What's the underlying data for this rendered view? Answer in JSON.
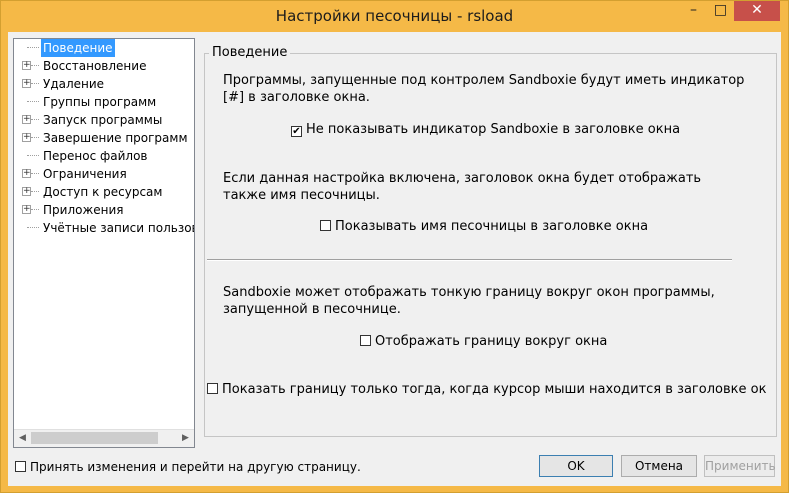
{
  "window": {
    "title": "Настройки песочницы - rsload",
    "controls": {
      "minimize": "–",
      "maximize": "□",
      "close": "✕"
    }
  },
  "tree": {
    "items": [
      {
        "label": "Поведение",
        "expander": "",
        "selected": true
      },
      {
        "label": "Восстановление",
        "expander": "+"
      },
      {
        "label": "Удаление",
        "expander": "+"
      },
      {
        "label": "Группы программ",
        "expander": ""
      },
      {
        "label": "Запуск программы",
        "expander": "+"
      },
      {
        "label": "Завершение программ",
        "expander": "+"
      },
      {
        "label": "Перенос файлов",
        "expander": ""
      },
      {
        "label": "Ограничения",
        "expander": "+"
      },
      {
        "label": "Доступ к ресурсам",
        "expander": "+"
      },
      {
        "label": "Приложения",
        "expander": "+"
      },
      {
        "label": "Учётные записи пользоват",
        "expander": ""
      }
    ],
    "scroll_left": "◀",
    "scroll_right": "▶"
  },
  "group": {
    "title": "Поведение",
    "text1": "Программы, запущенные под контролем Sandboxie будут иметь индикатор [#] в заголовке окна.",
    "cb1_label": "Не показывать индикатор Sandboxie в заголовке окна",
    "cb1_mark": "✔",
    "text2": "Если данная настройка включена, заголовок окна будет отображать также имя песочницы.",
    "cb2_label": "Показывать имя песочницы в заголовке окна",
    "text3": "Sandboxie может отображать тонкую границу вокруг окон программы, запущенной в песочнице.",
    "cb3_label": "Отображать границу вокруг окна",
    "cb4_label": "Показать границу только тогда, когда курсор мыши находится в заголовке ок"
  },
  "footer": {
    "apply_next_label": "Принять изменения и перейти на другую страницу.",
    "ok": "OK",
    "cancel": "Отмена",
    "apply": "Применить"
  }
}
